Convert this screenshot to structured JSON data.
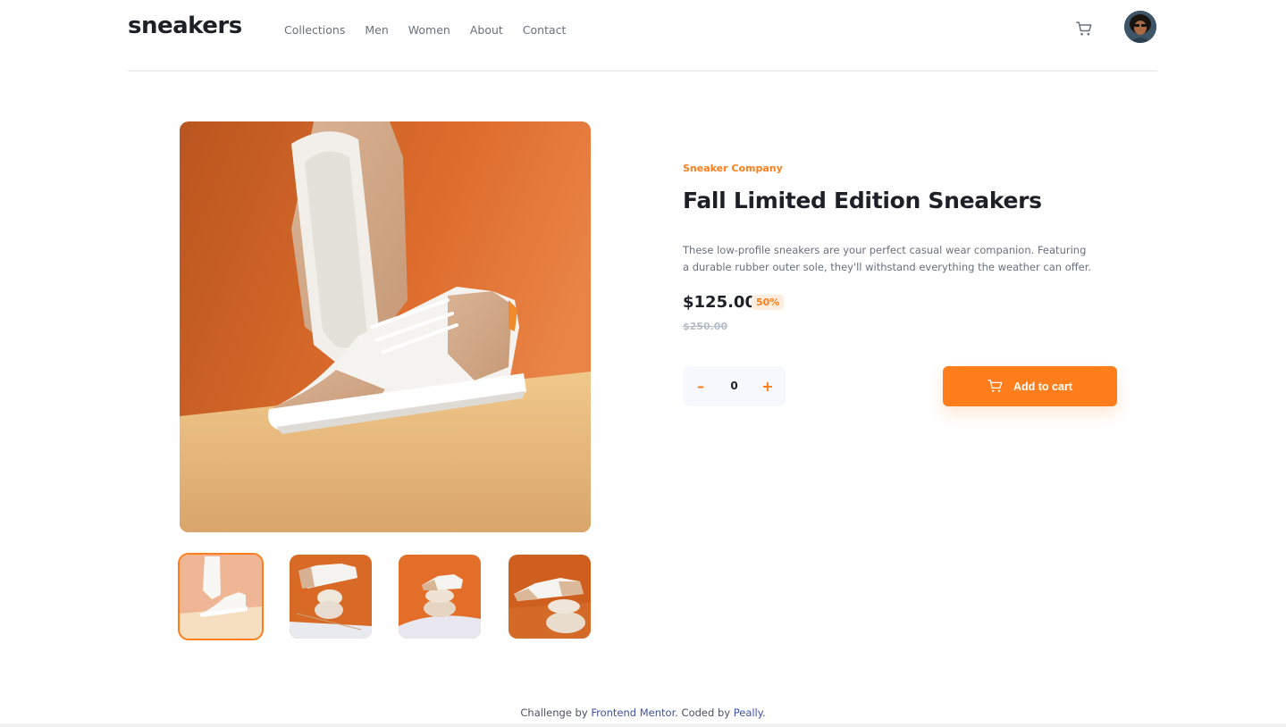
{
  "brand": {
    "logo": "sneakers"
  },
  "nav": {
    "items": [
      {
        "label": "Collections"
      },
      {
        "label": "Men"
      },
      {
        "label": "Women"
      },
      {
        "label": "About"
      },
      {
        "label": "Contact"
      }
    ]
  },
  "header": {
    "cart_icon": "cart-icon",
    "avatar": "user-avatar"
  },
  "gallery": {
    "main_image": "sneaker-product-photo-1",
    "thumbnails": [
      {
        "name": "thumbnail-1",
        "active": true
      },
      {
        "name": "thumbnail-2",
        "active": false
      },
      {
        "name": "thumbnail-3",
        "active": false
      },
      {
        "name": "thumbnail-4",
        "active": false
      }
    ]
  },
  "product": {
    "company": "Sneaker Company",
    "title": "Fall Limited Edition Sneakers",
    "description": "These low-profile sneakers are your perfect casual wear companion. Featuring a durable rubber outer sole, they'll withstand everything the weather can offer.",
    "price": "$125.00",
    "discount": "50%",
    "original_price": "$250.00"
  },
  "quantity": {
    "minus_label": "–",
    "value": "0",
    "plus_label": "+"
  },
  "cart_button": {
    "label": "Add to cart"
  },
  "footer": {
    "prefix": "Challenge by ",
    "link1": "Frontend Mentor",
    "middle": ". Coded by ",
    "link2": "Peally",
    "suffix": "."
  },
  "colors": {
    "accent": "#ff7e1b",
    "accent_pale": "#ffede0",
    "text_dark": "#1d2026",
    "text_grey": "#68707d"
  }
}
